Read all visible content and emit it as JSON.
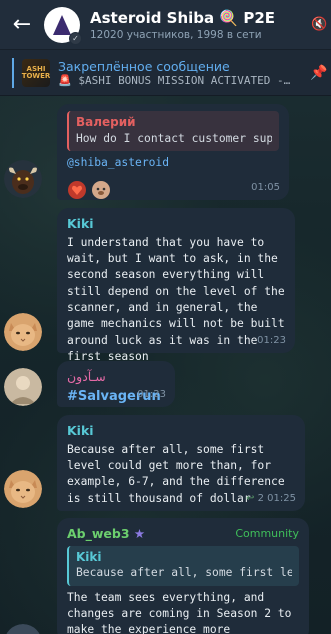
{
  "header": {
    "title": "Asteroid Shiba",
    "title_emoji": "🍭",
    "title_suffix": "P2E",
    "subtitle": "12020 участников, 1998 в сети",
    "back_icon": "←"
  },
  "pinned": {
    "label": "Закреплённое сообщение",
    "text": "$ASHI BONUS MISSION ACTIVATED -…",
    "thumb_text": "ASHI TOWER"
  },
  "messages": [
    {
      "reply_name": "Валерий",
      "reply_text": "How do I contact customer support?",
      "mention": "@shiba_asteroid",
      "time": "01:05"
    },
    {
      "sender": "Kiki",
      "text": "I understand that you have to wait, but I want to ask, in the second season everything will still depend on the level of the scanner, and in general, the game mechanics will not be built around luck as it was in the first season",
      "time": "01:23"
    },
    {
      "sender": "سـآدون",
      "hashtag": "#Salvagerun",
      "time": "01:23"
    },
    {
      "sender": "Kiki",
      "text": "Because after all, some first level could get more than, for example, 6-7, and the difference is still thousand of dollar",
      "replies": "2",
      "time": "01:25"
    },
    {
      "sender": "Ab_web3",
      "badge": "Community",
      "reply_name": "Kiki",
      "reply_text": "Because after all, some first level could…",
      "text": "The team sees everything, and changes are coming in Season 2 to make the experience more structured"
    }
  ],
  "colors": {
    "accent": "#62aef0",
    "reply_red": "#e36060",
    "kiki_cyan": "#58c9d6",
    "arabic_pink": "#e46aa6",
    "ab_green": "#6ccf6e",
    "community_green": "#3fbe5a"
  }
}
